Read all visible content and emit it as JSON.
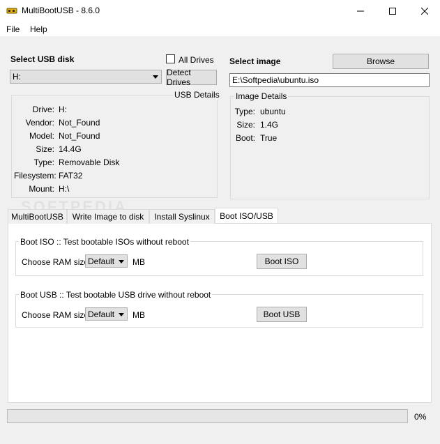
{
  "window": {
    "title": "MultiBootUSB - 8.6.0"
  },
  "menu": {
    "file": "File",
    "help": "Help"
  },
  "usb": {
    "heading": "Select USB disk",
    "all_drives_label": "All Drives",
    "all_drives_checked": false,
    "selected_disk": "H:",
    "detect_button": "Detect Drives",
    "details_title": "USB Details",
    "details": [
      {
        "label": "Drive:",
        "value": "H:"
      },
      {
        "label": "Vendor:",
        "value": "Not_Found"
      },
      {
        "label": "Model:",
        "value": "Not_Found"
      },
      {
        "label": "Size:",
        "value": "14.4G"
      },
      {
        "label": "Type:",
        "value": "Removable Disk"
      },
      {
        "label": "Filesystem:",
        "value": "FAT32"
      },
      {
        "label": "Mount:",
        "value": "H:\\"
      }
    ]
  },
  "image": {
    "heading": "Select image",
    "browse_button": "Browse",
    "path": "E:\\Softpedia\\ubuntu.iso",
    "details_title": "Image Details",
    "details": [
      {
        "label": "Type:",
        "value": "ubuntu"
      },
      {
        "label": "Size:",
        "value": "1.4G"
      },
      {
        "label": "Boot:",
        "value": "True"
      }
    ]
  },
  "tabs": [
    {
      "label": "MultiBootUSB",
      "active": false
    },
    {
      "label": "Write Image to disk",
      "active": false
    },
    {
      "label": "Install Syslinux",
      "active": false
    },
    {
      "label": "Boot ISO/USB",
      "active": true
    }
  ],
  "boot_iso": {
    "title": "Boot ISO :: Test bootable ISOs without reboot",
    "ram_label": "Choose RAM size:",
    "ram_value": "Default",
    "unit": "MB",
    "button": "Boot ISO"
  },
  "boot_usb": {
    "title": "Boot USB :: Test bootable USB drive without reboot",
    "ram_label": "Choose RAM size:",
    "ram_value": "Default",
    "unit": "MB",
    "button": "Boot USB"
  },
  "progress": {
    "value": 0,
    "text": "0%"
  },
  "watermark": "SOFTPEDIA",
  "colors": {
    "accent": "#0078d7",
    "progress_fill": "#06b025",
    "window_bg": "#f0f0f0"
  }
}
